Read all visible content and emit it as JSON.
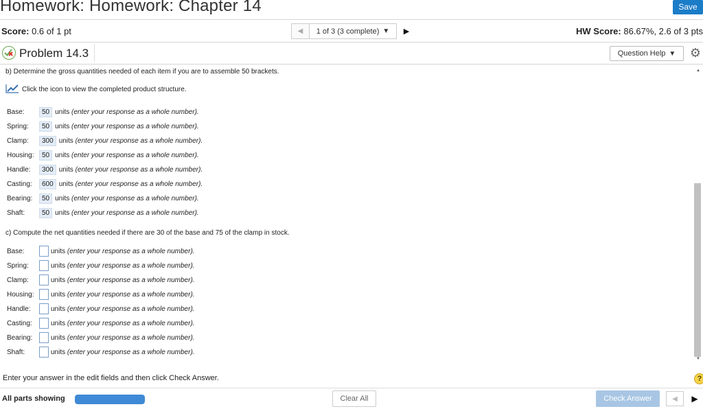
{
  "header": {
    "title": "Homework: Homework: Chapter 14",
    "save_label": "Save"
  },
  "score_bar": {
    "score_label": "Score:",
    "score_value": "0.6 of 1 pt",
    "pager_text": "1 of 3 (3 complete)",
    "hw_score_label": "HW Score:",
    "hw_score_value": "86.67%, 2.6 of 3 pts"
  },
  "problem": {
    "title": "Problem 14.3",
    "question_help_label": "Question Help"
  },
  "part_b": {
    "instruction": "b) Determine the gross quantities needed of each item if you are to assemble 50 brackets.",
    "icon_hint": "Click the icon to view the completed product structure.",
    "rows": [
      {
        "label": "Base:",
        "value": "50",
        "units": "units",
        "hint": "(enter your response as a whole number)."
      },
      {
        "label": "Spring:",
        "value": "50",
        "units": "units",
        "hint": "(enter your response as a whole number)."
      },
      {
        "label": "Clamp:",
        "value": "300",
        "units": "units",
        "hint": "(enter your response as a whole number)."
      },
      {
        "label": "Housing:",
        "value": "50",
        "units": "units",
        "hint": "(enter your response as a whole number)."
      },
      {
        "label": "Handle:",
        "value": "300",
        "units": "units",
        "hint": "(enter your response as a whole number)."
      },
      {
        "label": "Casting:",
        "value": "600",
        "units": "units",
        "hint": "(enter your response as a whole number)."
      },
      {
        "label": "Bearing:",
        "value": "50",
        "units": "units",
        "hint": "(enter your response as a whole number)."
      },
      {
        "label": "Shaft:",
        "value": "50",
        "units": "units",
        "hint": "(enter your response as a whole number)."
      }
    ]
  },
  "part_c": {
    "instruction": "c) Compute the net quantities needed if there are 30 of the base and 75 of the clamp in stock.",
    "rows": [
      {
        "label": "Base:",
        "units": "units",
        "hint": "(enter your response as a whole number)."
      },
      {
        "label": "Spring:",
        "units": "units",
        "hint": "(enter your response as a whole number)."
      },
      {
        "label": "Clamp:",
        "units": "units",
        "hint": "(enter your response as a whole number)."
      },
      {
        "label": "Housing:",
        "units": "units",
        "hint": "(enter your response as a whole number)."
      },
      {
        "label": "Handle:",
        "units": "units",
        "hint": "(enter your response as a whole number)."
      },
      {
        "label": "Casting:",
        "units": "units",
        "hint": "(enter your response as a whole number)."
      },
      {
        "label": "Bearing:",
        "units": "units",
        "hint": "(enter your response as a whole number)."
      },
      {
        "label": "Shaft:",
        "units": "units",
        "hint": "(enter your response as a whole number)."
      }
    ]
  },
  "footer": {
    "enter_text": "Enter your answer in the edit fields and then click Check Answer.",
    "help_symbol": "?",
    "all_parts_label": "All parts showing",
    "progress_fraction": 1.0,
    "clear_all_label": "Clear All",
    "check_answer_label": "Check Answer"
  },
  "colors": {
    "accent": "#1b7cc8",
    "progress": "#3f8ad6",
    "check_disabled": "#a8c6e4",
    "answer_bg": "#e3ecf7"
  },
  "icons": {
    "problem_status": "partial-credit-icon",
    "chart_link": "line-chart-icon",
    "settings": "gear-icon"
  }
}
